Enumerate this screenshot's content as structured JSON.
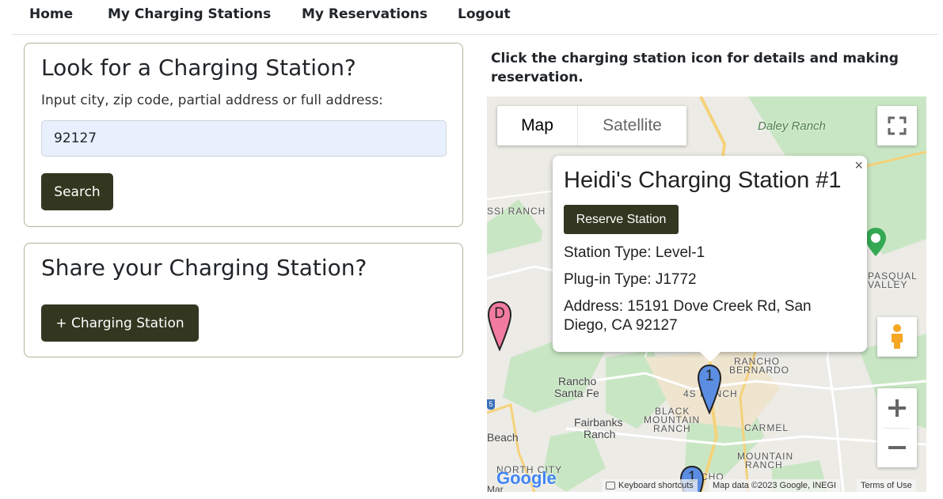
{
  "nav": {
    "home": "Home",
    "my_stations": "My Charging Stations",
    "my_reservations": "My Reservations",
    "logout": "Logout"
  },
  "search_card": {
    "title": "Look for a Charging Station?",
    "label": "Input city, zip code, partial address or full address:",
    "input_value": "92127",
    "search_button": "Search"
  },
  "share_card": {
    "title": "Share your Charging Station?",
    "add_button": "+ Charging Station"
  },
  "map_hint": "Click the charging station icon for details and making reservation.",
  "map": {
    "type_map": "Map",
    "type_satellite": "Satellite",
    "places": {
      "daley_ranch": "Daley Ranch",
      "ssi_ranch": "SSI RANCH",
      "pasqual": "PASQUAL",
      "valley": "VALLEY",
      "rancho_bernardo_1": "RANCHO",
      "rancho_bernardo_2": "BERNARDO",
      "rancho_santa_fe_1": "Rancho",
      "rancho_santa_fe_2": "Santa Fe",
      "four_s_ranch": "4S RANCH",
      "black_mountain_1": "BLACK",
      "black_mountain_2": "MOUNTAIN",
      "black_mountain_3": "RANCH",
      "fairbanks_1": "Fairbanks",
      "fairbanks_2": "Ranch",
      "carmel_1": "CARMEL",
      "carmel_2": "MOUNTAIN",
      "carmel_3": "RANCH",
      "beach": "Beach",
      "north_city": "NORTH CITY",
      "route_5": "5",
      "mar": "Mar",
      "cho": "CHO"
    },
    "markers": {
      "d_label": "D",
      "one_label": "1",
      "one_label_b": "1"
    },
    "google_logo": "Google",
    "attribution": {
      "shortcuts": "Keyboard shortcuts",
      "map_data": "Map data ©2023 Google, INEGI",
      "terms": "Terms of Use"
    },
    "popup": {
      "title": "Heidi's Charging Station #1",
      "reserve_button": "Reserve Station",
      "station_type": "Station Type: Level-1",
      "plug_type": "Plug-in Type: J1772",
      "address": "Address: 15191 Dove Creek Rd, San Diego, CA 92127",
      "close": "×"
    }
  },
  "colors": {
    "accent": "#333720",
    "marker_pink": "#f27ba0",
    "marker_blue": "#5b8de3"
  }
}
